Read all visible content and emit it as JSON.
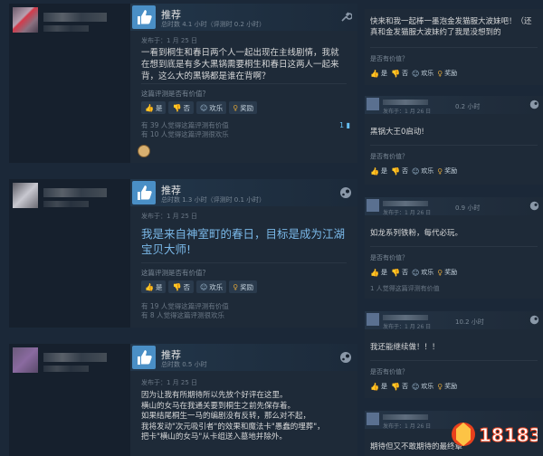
{
  "reviews": [
    {
      "title": "推荐",
      "hours": "总时数 4.1 小时（评测时 0.2 小时）",
      "posted": "发布于：1 月 25 日",
      "text": "一看到桐生和春日两个人一起出现在主线剧情，我就在想到底是有多大黑锅需要桐生和春日这两人一起来背，这么大的黑锅都是谁在背啊？",
      "question": "这篇评测是否有价值？",
      "buttons": {
        "yes": "是",
        "no": "否",
        "funny": "欢乐",
        "award": "奖励"
      },
      "stat1": "有 39 人觉得这篇评测有价值",
      "stat2": "有 10 人觉得这篇评测很欢乐",
      "comments": "1"
    },
    {
      "title": "推荐",
      "hours": "总时数 1.3 小时（评测时 0.1 小时）",
      "posted": "发布于：1 月 25 日",
      "text": "我是来自神室町的春日，目标是成为江湖宝贝大师!",
      "question": "这篇评测是否有价值？",
      "buttons": {
        "yes": "是",
        "no": "否",
        "funny": "欢乐",
        "award": "奖励"
      },
      "stat1": "有 19 人觉得这篇评测有价值",
      "stat2": "有 8 人觉得这篇评测很欢乐"
    },
    {
      "title": "推荐",
      "hours": "总时数 0.5 小时",
      "posted": "发布于：1 月 25 日",
      "lines": [
        "因为让我有所期待所以先放个好评在这里。",
        "横山的女马在我通关要到桐生之前先保存着。",
        "如果结尾桐生一马的编剧没有反转，那么对不起，",
        "我将发动\"次元吸引者\"的效果和魔法卡\"愚蠢的埋葬\"，",
        "把卡\"横山的女马\"从卡组送入墓地并除外。"
      ]
    }
  ],
  "side_comments": [
    {
      "text": "快来和我一起棒一墨泡金发猫服大波妹吧！（还真和金发猫服大波妹约了我是没想到的",
      "question": "是否有价值？",
      "buttons": {
        "yes": "是",
        "no": "否",
        "funny": "欢乐",
        "award": "奖励"
      }
    },
    {
      "posted": "发布于：1 月 26 日",
      "hours": "0.2 小时",
      "text": "黑锅大王0启动!",
      "question": "是否有价值？",
      "buttons": {
        "yes": "是",
        "no": "否",
        "funny": "欢乐",
        "award": "奖励"
      }
    },
    {
      "posted": "发布于：1 月 26 日",
      "hours": "0.9 小时",
      "text": "如龙系列铁粉，每代必玩。",
      "question": "是否有价值？",
      "buttons": {
        "yes": "是",
        "no": "否",
        "funny": "欢乐",
        "award": "奖励"
      },
      "stat": "1 人觉得这篇评测有价值"
    },
    {
      "posted": "发布于：1 月 26 日",
      "hours": "10.2 小时",
      "text": "我还能继续做！！！",
      "question": "是否有价值？",
      "buttons": {
        "yes": "是",
        "no": "否",
        "funny": "欢乐",
        "award": "奖励"
      }
    },
    {
      "posted": "发布于：1 月 26 日",
      "text": "期待但又不敢期待的最终章"
    }
  ],
  "watermark": "18183",
  "colors": {
    "bg": "#1b2838",
    "thumb": "#4a8fc6",
    "accent": "#66c0f4",
    "award": "#d6a03a"
  }
}
